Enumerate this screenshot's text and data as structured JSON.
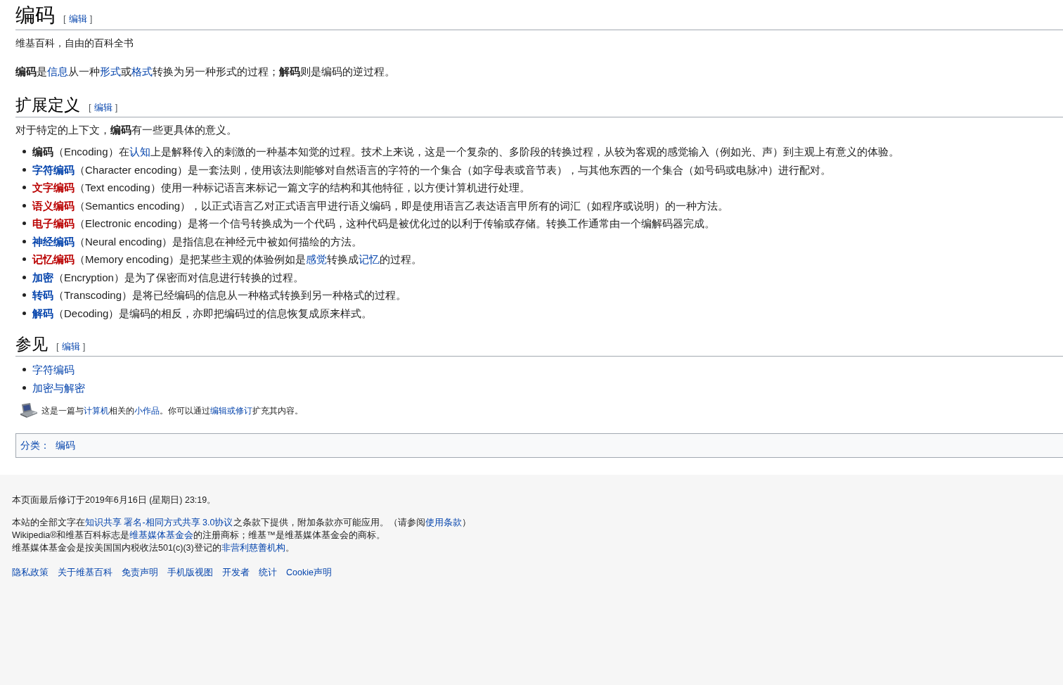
{
  "title": {
    "text": "编码",
    "edit": {
      "open": "[",
      "label": "编辑",
      "close": "]"
    }
  },
  "tagline": "维基百科，自由的百科全书",
  "intro": [
    {
      "kind": "b",
      "text": "编码"
    },
    {
      "kind": "text",
      "text": "是"
    },
    {
      "kind": "link",
      "text": "信息"
    },
    {
      "kind": "text",
      "text": "从一种"
    },
    {
      "kind": "link",
      "text": "形式"
    },
    {
      "kind": "text",
      "text": "或"
    },
    {
      "kind": "link",
      "text": "格式"
    },
    {
      "kind": "text",
      "text": "转换为另一种形式的过程；"
    },
    {
      "kind": "b",
      "text": "解码"
    },
    {
      "kind": "text",
      "text": "则是编码的逆过程。"
    }
  ],
  "sections": [
    {
      "heading": "扩展定义",
      "edit": {
        "open": "[",
        "label": "编辑",
        "close": "]"
      },
      "lead": [
        {
          "kind": "text",
          "text": "对于特定的上下文，"
        },
        {
          "kind": "b",
          "text": "编码"
        },
        {
          "kind": "text",
          "text": "有一些更具体的意义。"
        }
      ],
      "items": [
        [
          {
            "kind": "b",
            "text": "编码"
          },
          {
            "kind": "text",
            "text": "（Encoding）在"
          },
          {
            "kind": "link",
            "text": "认知"
          },
          {
            "kind": "text",
            "text": "上是解释传入的刺激的一种基本知觉的过程。技术上来说，这是一个复杂的、多阶段的转换过程，从较为客观的感觉输入（例如光、声）到主观上有意义的体验。"
          }
        ],
        [
          {
            "kind": "link_b",
            "text": "字符编码"
          },
          {
            "kind": "text",
            "text": "（Character encoding）是一套法则，使用该法则能够对自然语言的字符的一个集合（如字母表或音节表），与其他东西的一个集合（如号码或电脉冲）进行配对。"
          }
        ],
        [
          {
            "kind": "red_b",
            "text": "文字编码"
          },
          {
            "kind": "text",
            "text": "（Text encoding）使用一种标记语言来标记一篇文字的结构和其他特征，以方便计算机进行处理。"
          }
        ],
        [
          {
            "kind": "red_b",
            "text": "语义编码"
          },
          {
            "kind": "text",
            "text": "（Semantics encoding），以正式语言乙对正式语言甲进行语义编码，即是使用语言乙表达语言甲所有的词汇（如程序或说明）的一种方法。"
          }
        ],
        [
          {
            "kind": "red_b",
            "text": "电子编码"
          },
          {
            "kind": "text",
            "text": "（Electronic encoding）是将一个信号转换成为一个代码，这种代码是被优化过的以利于传输或存储。转换工作通常由一个编解码器完成。"
          }
        ],
        [
          {
            "kind": "link_b",
            "text": "神经编码"
          },
          {
            "kind": "text",
            "text": "（Neural encoding）是指信息在神经元中被如何描绘的方法。"
          }
        ],
        [
          {
            "kind": "red_b",
            "text": "记忆编码"
          },
          {
            "kind": "text",
            "text": "（Memory encoding）是把某些主观的体验例如是"
          },
          {
            "kind": "link",
            "text": "感觉"
          },
          {
            "kind": "text",
            "text": "转换成"
          },
          {
            "kind": "link",
            "text": "记忆"
          },
          {
            "kind": "text",
            "text": "的过程。"
          }
        ],
        [
          {
            "kind": "link_b",
            "text": "加密"
          },
          {
            "kind": "text",
            "text": "（Encryption）是为了保密而对信息进行转换的过程。"
          }
        ],
        [
          {
            "kind": "link_b",
            "text": "转码"
          },
          {
            "kind": "text",
            "text": "（Transcoding）是将已经编码的信息从一种格式转换到另一种格式的过程。"
          }
        ],
        [
          {
            "kind": "link_b",
            "text": "解码"
          },
          {
            "kind": "text",
            "text": "（Decoding）是编码的相反，亦即把编码过的信息恢复成原来样式。"
          }
        ]
      ]
    },
    {
      "heading": "参见",
      "edit": {
        "open": "[",
        "label": "编辑",
        "close": "]"
      },
      "items": [
        [
          {
            "kind": "link",
            "text": "字符编码"
          }
        ],
        [
          {
            "kind": "link",
            "text": "加密与解密"
          }
        ]
      ]
    }
  ],
  "stub": [
    {
      "kind": "text",
      "text": "这是一篇与"
    },
    {
      "kind": "link",
      "text": "计算机"
    },
    {
      "kind": "text",
      "text": "相关的"
    },
    {
      "kind": "link",
      "text": "小作品"
    },
    {
      "kind": "text",
      "text": "。你可以通过"
    },
    {
      "kind": "link",
      "text": "编辑或修订"
    },
    {
      "kind": "text",
      "text": "扩充其内容。"
    }
  ],
  "categories": {
    "label": "分类：",
    "items": [
      "编码"
    ]
  },
  "footer": {
    "lines": [
      [
        {
          "kind": "text",
          "text": "本页面最后修订于2019年6月16日 (星期日) 23:19。"
        }
      ],
      [
        {
          "kind": "text",
          "text": "本站的全部文字在"
        },
        {
          "kind": "link",
          "text": "知识共享 署名-相同方式共享 3.0协议"
        },
        {
          "kind": "text",
          "text": "之条款下提供，附加条款亦可能应用。（请参阅"
        },
        {
          "kind": "link",
          "text": "使用条款"
        },
        {
          "kind": "text",
          "text": "）"
        }
      ],
      [
        {
          "kind": "text",
          "text": "Wikipedia®和维基百科标志是"
        },
        {
          "kind": "link",
          "text": "维基媒体基金会"
        },
        {
          "kind": "text",
          "text": "的注册商标；维基™是维基媒体基金会的商标。"
        }
      ],
      [
        {
          "kind": "text",
          "text": "维基媒体基金会是按美国国内税收法501(c)(3)登记的"
        },
        {
          "kind": "link",
          "text": "非营利慈善机构"
        },
        {
          "kind": "text",
          "text": "。"
        }
      ]
    ],
    "links": [
      "隐私政策",
      "关于维基百科",
      "免责声明",
      "手机版视图",
      "开发者",
      "统计",
      "Cookie声明"
    ]
  }
}
